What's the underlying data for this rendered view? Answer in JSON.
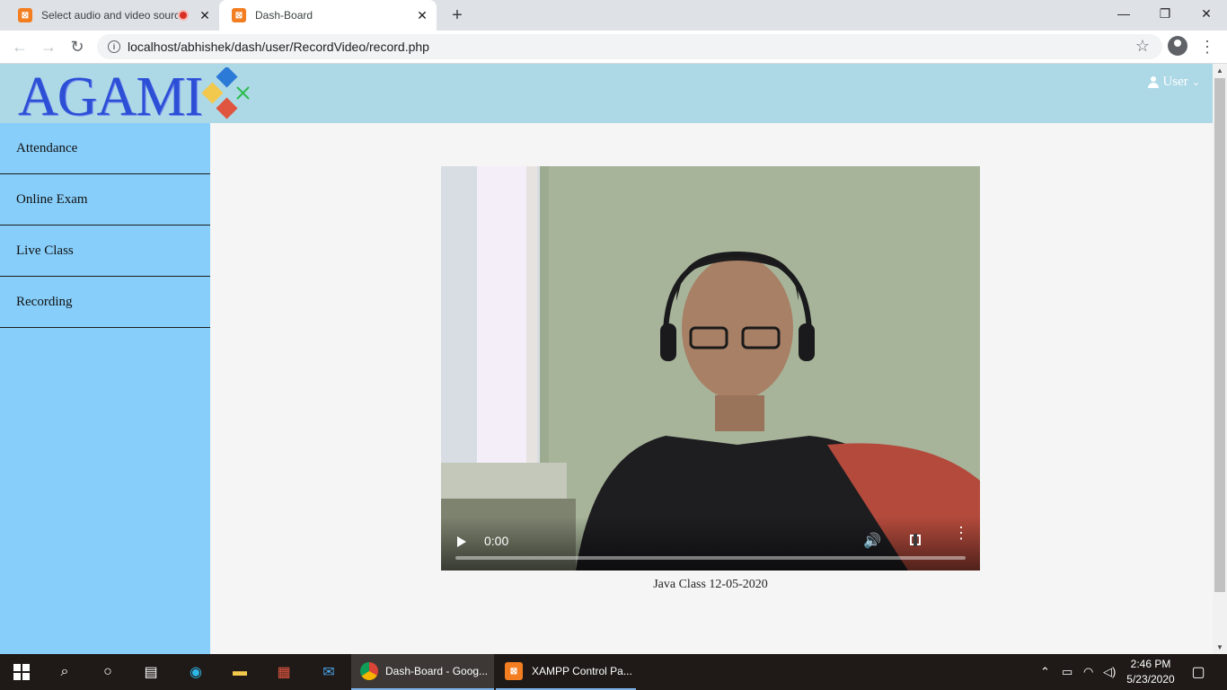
{
  "browser": {
    "tabs": [
      {
        "title": "Select audio and video sourc",
        "recording": true
      },
      {
        "title": "Dash-Board",
        "active": true
      }
    ],
    "url": "localhost/abhishek/dash/user/RecordVideo/record.php"
  },
  "header": {
    "logo_text": "AGAMI",
    "user_label": "User"
  },
  "sidebar": {
    "items": [
      {
        "label": "Attendance"
      },
      {
        "label": "Online Exam"
      },
      {
        "label": "Live Class"
      },
      {
        "label": "Recording"
      }
    ]
  },
  "video": {
    "time": "0:00",
    "caption": "Java Class 12-05-2020"
  },
  "taskbar": {
    "apps": [
      {
        "label": "Dash-Board - Goog..."
      },
      {
        "label": "XAMPP Control Pa..."
      }
    ],
    "time": "2:46 PM",
    "date": "5/23/2020"
  },
  "colors": {
    "header_bg": "#add8e6",
    "sidebar_bg": "#87cefa",
    "logo": "#2c4fd6"
  }
}
